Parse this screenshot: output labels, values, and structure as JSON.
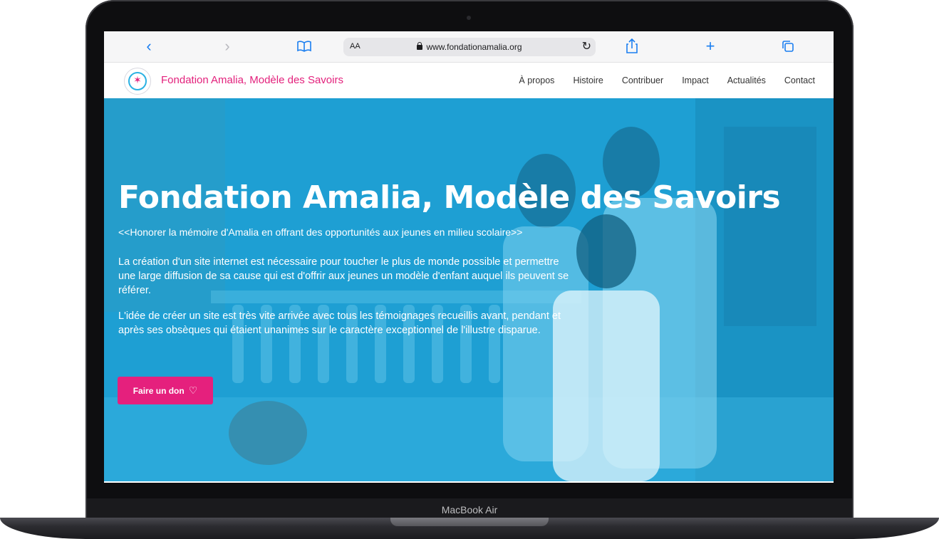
{
  "device": {
    "label": "MacBook Air"
  },
  "browser": {
    "text_size_label": "AA",
    "url": "www.fondationamalia.org",
    "icons": [
      "back-icon",
      "forward-icon",
      "bookmarks-icon",
      "lock-icon",
      "reload-icon",
      "share-icon",
      "new-tab-icon",
      "tabs-icon"
    ]
  },
  "site": {
    "brand": "Fondation Amalia, Modèle des Savoirs",
    "nav": [
      "À propos",
      "Histoire",
      "Contribuer",
      "Impact",
      "Actualités",
      "Contact"
    ],
    "hero": {
      "title": "Fondation Amalia, Modèle des Savoirs",
      "subtitle": "<<Honorer la mémoire d'Amalia en offrant des opportunités aux jeunes en milieu scolaire>>",
      "paragraph_1": "La création d'un site internet est nécessaire pour toucher le plus de monde possible et permettre une large diffusion de sa cause qui est d'offrir aux jeunes un modèle d'enfant auquel ils peuvent se référer.",
      "paragraph_2": "L'idée de créer un site est très vite arrivée avec tous les témoignages recueillis avant, pendant et après ses obsèques qui étaient unanimes sur le caractère exceptionnel de l'illustre disparue.",
      "donate_label": "Faire un don"
    }
  },
  "colors": {
    "accent": "#e5207d",
    "hero_overlay": "#1fa3d6",
    "link": "#1a7ef0"
  }
}
